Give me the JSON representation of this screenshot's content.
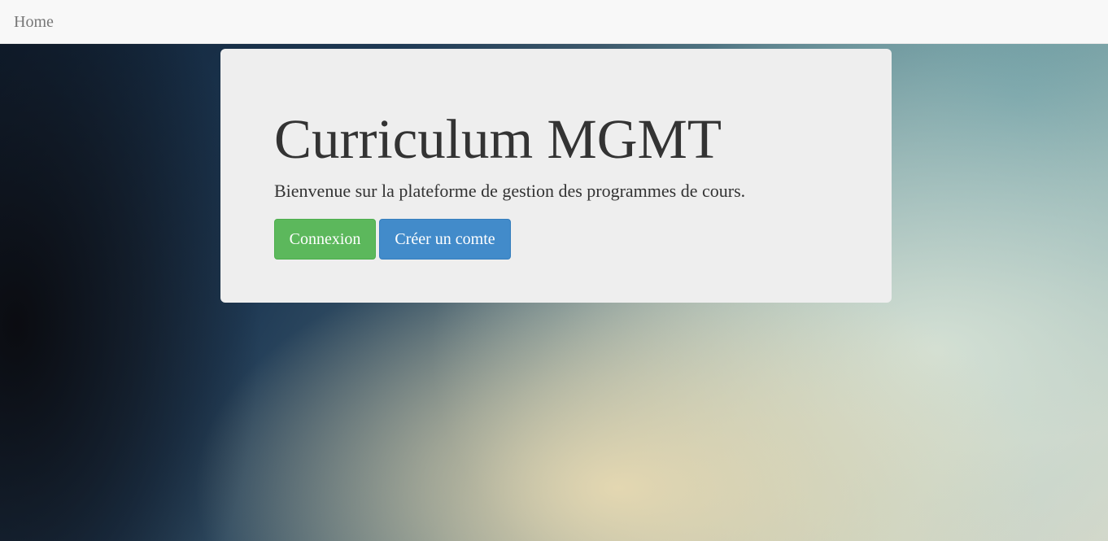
{
  "navbar": {
    "brand": "Home"
  },
  "jumbotron": {
    "title": "Curriculum MGMT",
    "subtitle": "Bienvenue sur la plateforme de gestion des programmes de cours.",
    "login_button": "Connexion",
    "register_button": "Créer un comte"
  },
  "colors": {
    "navbar_bg": "#f8f8f8",
    "navbar_text": "#777777",
    "jumbotron_bg": "#eeeeee",
    "success": "#5cb85c",
    "primary": "#428bca",
    "text": "#333333"
  }
}
